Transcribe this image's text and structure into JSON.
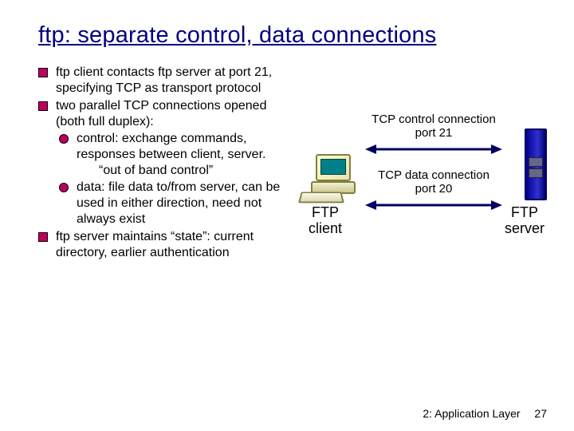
{
  "title": "ftp: separate control, data connections",
  "bullets": {
    "b1": "ftp client contacts ftp server at port 21, specifying TCP as transport protocol",
    "b2": "two parallel TCP connections opened (both full duplex):",
    "b2a": "control: exchange commands, responses between client, server.",
    "b2a_tag": "“out of band control”",
    "b2b": "data: file data to/from server, can be used in either direction, need not always exist",
    "b3": "ftp server maintains “state”: current directory, earlier authentication"
  },
  "diagram": {
    "control_caption_l1": "TCP control connection",
    "control_caption_l2": "port 21",
    "data_caption_l1": "TCP data connection",
    "data_caption_l2": "port 20",
    "client_label": "FTP\nclient",
    "server_label": "FTP\nserver"
  },
  "footer": {
    "chapter": "2: Application Layer",
    "page": "27"
  }
}
